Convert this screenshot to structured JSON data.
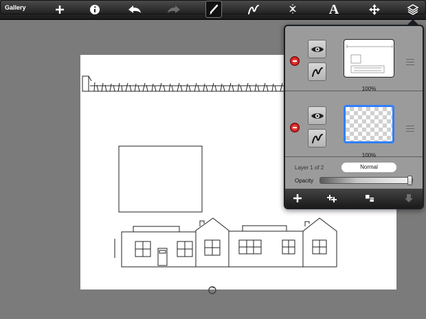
{
  "toolbar": {
    "gallery_label": "Gallery",
    "icons": [
      "add-icon",
      "info-icon",
      "undo-icon",
      "redo-icon",
      "brush-icon",
      "pen-icon",
      "symmetry-icon",
      "text-tool-icon",
      "move-icon",
      "layers-icon"
    ],
    "text_tool_glyph": "A"
  },
  "layers_panel": {
    "layers": [
      {
        "opacity_label": "100%",
        "selected": false
      },
      {
        "opacity_label": "100%",
        "selected": true
      }
    ],
    "layer_info": "Layer 1 of 2",
    "blend_mode": "Normal",
    "opacity_label": "Opacity",
    "opacity_value": 1.0,
    "footer_icons": [
      "add-layer-icon",
      "duplicate-layer-icon",
      "merge-layer-icon",
      "move-down-icon"
    ]
  },
  "colors": {
    "background": "#7b7b7b",
    "toolbar": "#2a2a2a",
    "selection": "#2f7fff",
    "delete": "#d40000"
  }
}
